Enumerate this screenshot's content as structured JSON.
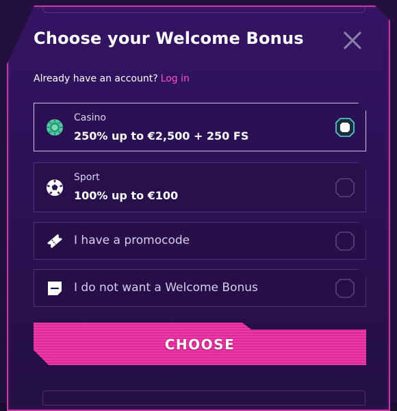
{
  "modal": {
    "title": "Choose your Welcome Bonus",
    "account_prompt": "Already have an account?",
    "login_link": "Log in"
  },
  "options": [
    {
      "category": "Casino",
      "value": "250% up to €2,500 + 250 FS",
      "icon": "casino-chip-icon",
      "selected": true
    },
    {
      "category": "Sport",
      "value": "100% up to €100",
      "icon": "soccer-ball-icon",
      "selected": false
    },
    {
      "label": "I have a promocode",
      "icon": "ticket-icon",
      "selected": false
    },
    {
      "label": "I do not want a Welcome Bonus",
      "icon": "no-bonus-icon",
      "selected": false
    }
  ],
  "choose_button": {
    "label": "CHOOSE"
  },
  "colors": {
    "accent": "#f03aa9",
    "link": "#ff4fc0",
    "border_glow": "#c83aa8",
    "selected_radio": "#5fd3e0"
  }
}
